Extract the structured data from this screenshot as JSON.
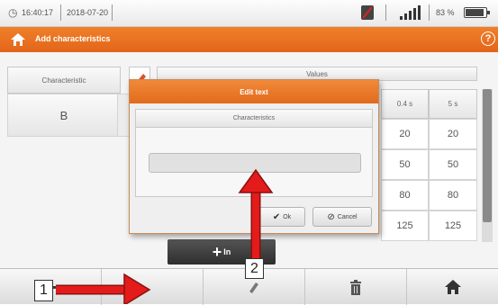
{
  "status_bar": {
    "time": "16:40:17",
    "date": "2018-07-20",
    "battery_percent": "83 %"
  },
  "title_bar": {
    "title": "Add characteristics",
    "help_icon": "help-icon",
    "home_icon": "home-icon"
  },
  "table": {
    "header_characteristic": "Characteristic",
    "header_values": "Values",
    "col_04s": "0.4 s",
    "col_5s": "5 s",
    "row_label": "B",
    "values_04s": [
      "20",
      "50",
      "80",
      "125"
    ],
    "values_5s": [
      "20",
      "50",
      "80",
      "125"
    ]
  },
  "add_button": {
    "label": "In"
  },
  "dialog": {
    "title": "Edit text",
    "field_label": "Characteristics",
    "input_value": "",
    "ok_label": "Ok",
    "cancel_label": "Cancel"
  },
  "toolbar": {
    "icons": [
      "plus-icon",
      "pencil-icon",
      "trash-icon",
      "home-icon"
    ]
  },
  "annotations": {
    "label_1": "1",
    "label_2": "2",
    "arrow_color": "#e31b1b"
  },
  "colors": {
    "accent": "#e8701f",
    "dialog_title": "#e8701f"
  }
}
